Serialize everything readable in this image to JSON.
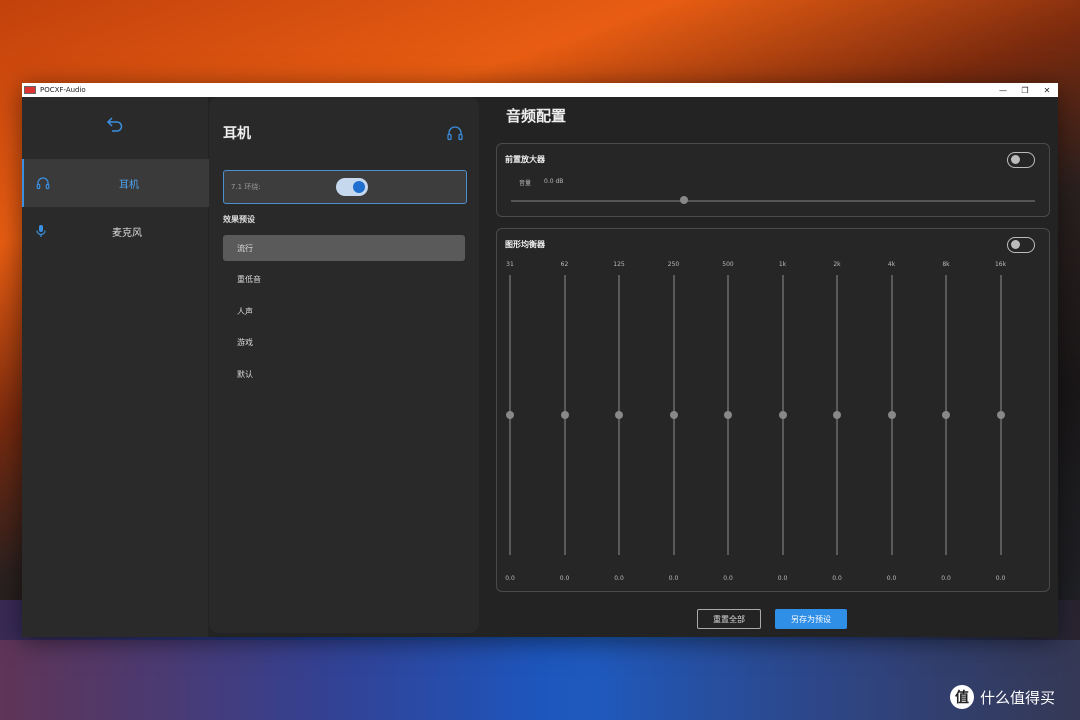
{
  "window": {
    "title": "POCXF-Audio",
    "controls": [
      "—",
      "❐",
      "✕"
    ]
  },
  "sidebar": {
    "items": [
      {
        "label": "耳机",
        "icon": "headphones-icon",
        "active": true
      },
      {
        "label": "麦克风",
        "icon": "microphone-icon",
        "active": false
      }
    ]
  },
  "panel": {
    "title": "耳机",
    "surround_label": "7.1 环绕:",
    "surround_on": true,
    "preset_heading": "效果预设",
    "presets": [
      "流行",
      "重低音",
      "人声",
      "游戏",
      "默认"
    ],
    "active_preset": 0
  },
  "main": {
    "title": "音频配置",
    "preamp": {
      "title": "前置放大器",
      "enabled": false,
      "volume_label": "音量",
      "volume_value": "0.0 dB",
      "level": 0.33
    },
    "eq": {
      "title": "图形均衡器",
      "enabled": false,
      "bands": [
        {
          "freq": "31",
          "gain": "0.0"
        },
        {
          "freq": "62",
          "gain": "0.0"
        },
        {
          "freq": "125",
          "gain": "0.0"
        },
        {
          "freq": "250",
          "gain": "0.0"
        },
        {
          "freq": "500",
          "gain": "0.0"
        },
        {
          "freq": "1k",
          "gain": "0.0"
        },
        {
          "freq": "2k",
          "gain": "0.0"
        },
        {
          "freq": "4k",
          "gain": "0.0"
        },
        {
          "freq": "8k",
          "gain": "0.0"
        },
        {
          "freq": "16k",
          "gain": "0.0"
        }
      ]
    },
    "buttons": {
      "reset": "重置全部",
      "save": "另存为预设"
    }
  },
  "watermark": {
    "logo": "值",
    "text": "什么值得买"
  },
  "colors": {
    "accent": "#2f8ee6",
    "window_bg": "#232324"
  }
}
